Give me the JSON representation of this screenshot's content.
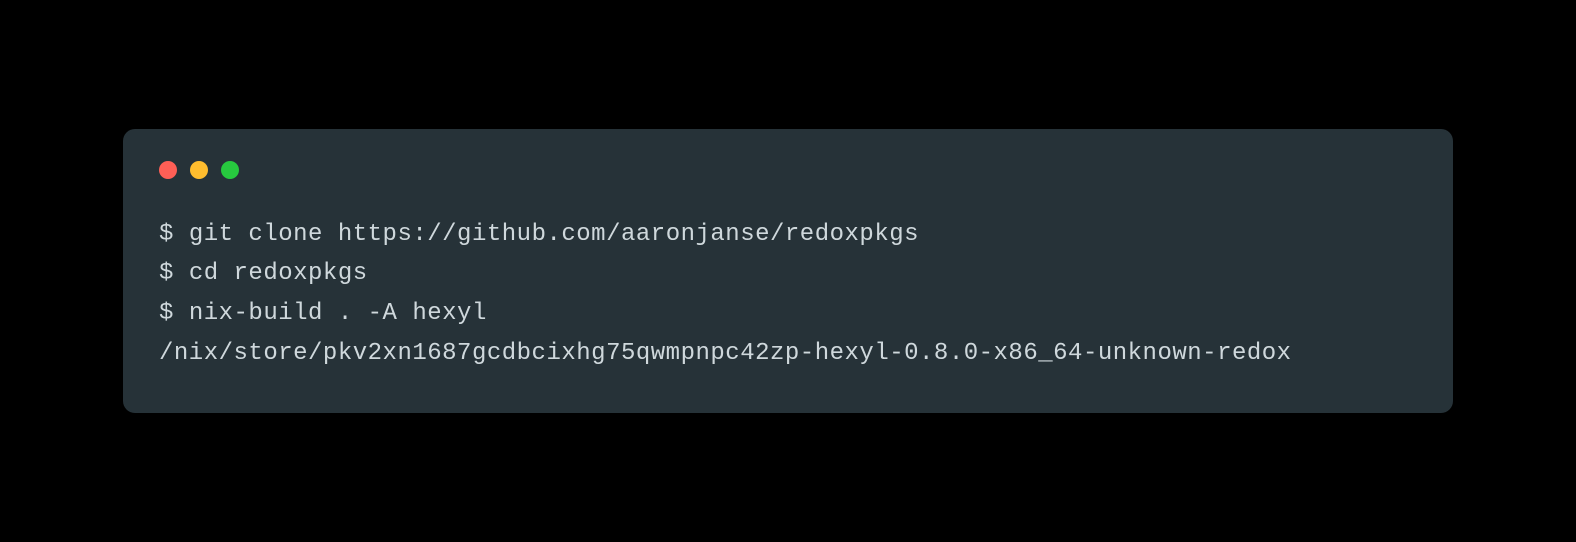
{
  "terminal": {
    "lines": [
      {
        "prompt": "$ ",
        "command": "git clone https://github.com/aaronjanse/redoxpkgs"
      },
      {
        "prompt": "$ ",
        "command": "cd redoxpkgs"
      },
      {
        "prompt": "$ ",
        "command": "nix-build . -A hexyl"
      }
    ],
    "output": "/nix/store/pkv2xn1687gcdbcixhg75qwmpnpc42zp-hexyl-0.8.0-x86_64-unknown-redox"
  },
  "colors": {
    "background": "#000000",
    "terminal_bg": "#263238",
    "text": "#cfd8dc",
    "red": "#ff5f56",
    "yellow": "#ffbd2e",
    "green": "#27c93f"
  }
}
